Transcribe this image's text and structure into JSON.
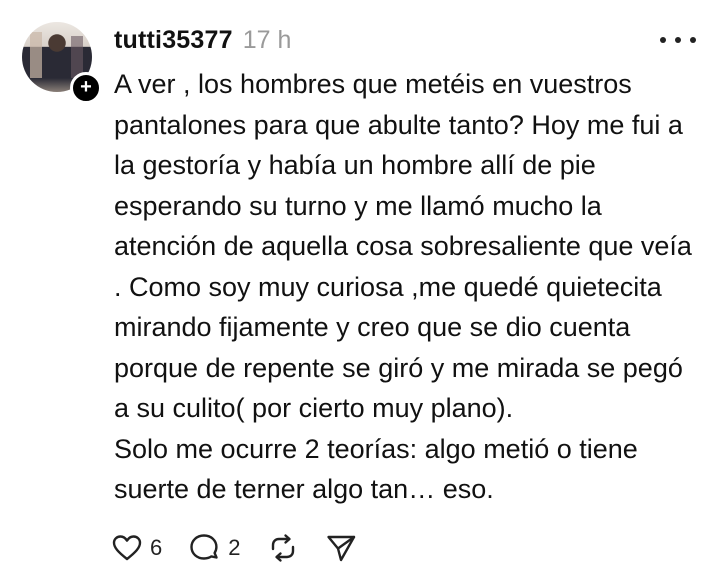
{
  "post": {
    "username": "tutti35377",
    "time": "17 h",
    "follow_symbol": "+",
    "paragraphs": [
      "A ver , los hombres que metéis en vuestros pantalones para que abulte tanto? Hoy me fui a la gestoría y había un hombre allí de pie esperando su turno y me llamó mucho la atención de aquella cosa sobresaliente que veía . Como soy muy curiosa ,me quedé quietecita mirando fijamente y creo que se dio cuenta porque de repente se giró y me mirada se pegó a su culito( por cierto muy plano).",
      "Solo me ocurre 2 teorías: algo metió o tiene suerte de terner algo tan… eso."
    ]
  },
  "actions": {
    "like_icon": "heart-icon",
    "like_count": "6",
    "reply_icon": "comment-icon",
    "reply_count": "2",
    "repost_icon": "repost-icon",
    "share_icon": "send-icon"
  }
}
